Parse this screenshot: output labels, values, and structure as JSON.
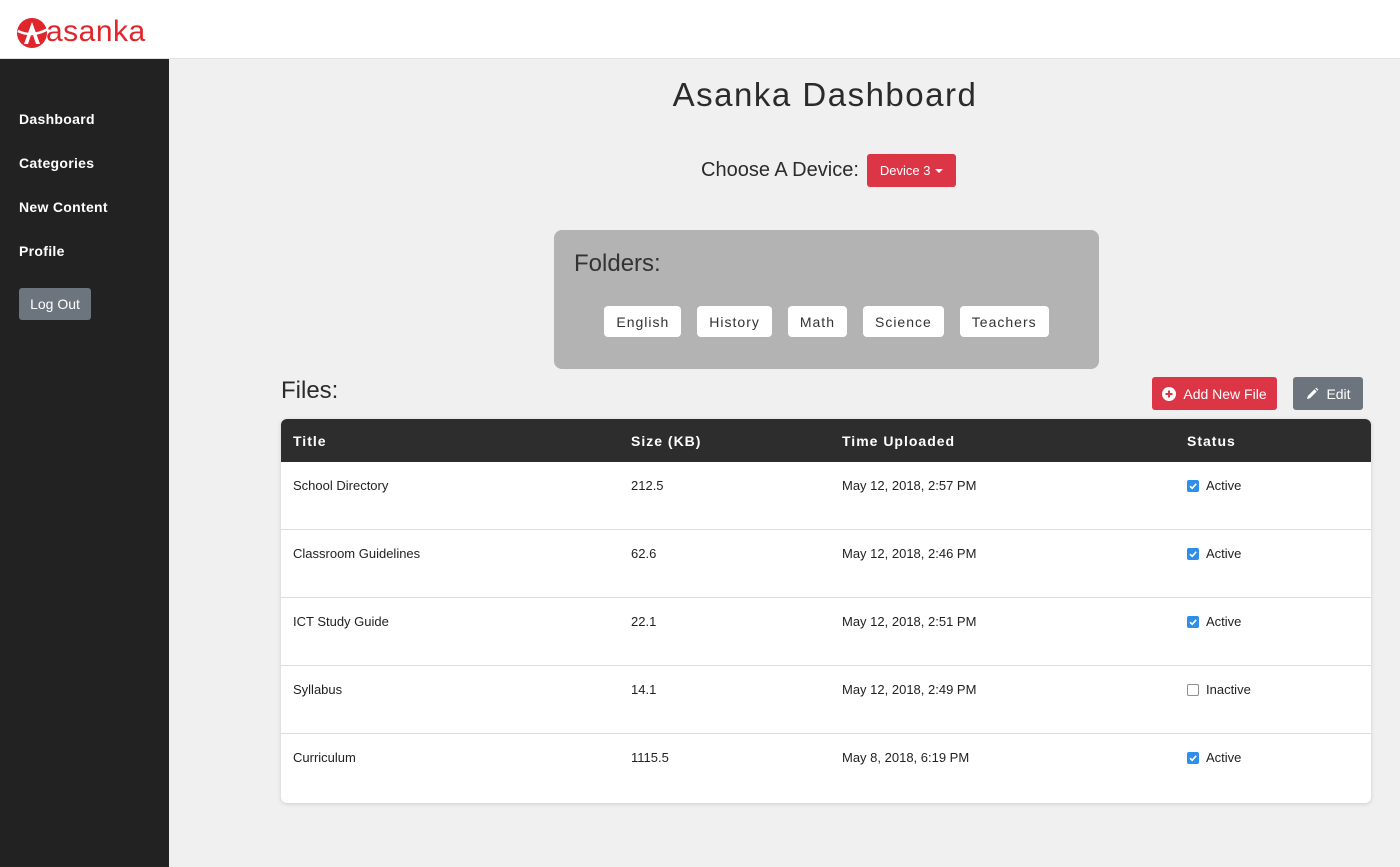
{
  "brand": {
    "name": "asanka",
    "color": "#e0262d"
  },
  "sidebar": {
    "items": [
      {
        "label": "Dashboard"
      },
      {
        "label": "Categories"
      },
      {
        "label": "New Content"
      },
      {
        "label": "Profile"
      }
    ],
    "logout_label": "Log Out"
  },
  "header": {
    "title": "Asanka Dashboard",
    "device_label": "Choose A Device:",
    "device_selected": "Device 3"
  },
  "folders": {
    "title": "Folders:",
    "items": [
      "English",
      "History",
      "Math",
      "Science",
      "Teachers"
    ]
  },
  "files": {
    "title": "Files:",
    "add_label": "Add New File",
    "edit_label": "Edit",
    "columns": [
      "Title",
      "Size (KB)",
      "Time Uploaded",
      "Status"
    ],
    "rows": [
      {
        "title": "School Directory",
        "size": "212.5",
        "time": "May 12, 2018, 2:57 PM",
        "status": "Active",
        "checked": true
      },
      {
        "title": "Classroom Guidelines",
        "size": "62.6",
        "time": "May 12, 2018, 2:46 PM",
        "status": "Active",
        "checked": true
      },
      {
        "title": "ICT Study Guide",
        "size": "22.1",
        "time": "May 12, 2018, 2:51 PM",
        "status": "Active",
        "checked": true
      },
      {
        "title": "Syllabus",
        "size": "14.1",
        "time": "May 12, 2018, 2:49 PM",
        "status": "Inactive",
        "checked": false
      },
      {
        "title": "Curriculum",
        "size": "1115.5",
        "time": "May 8, 2018, 6:19 PM",
        "status": "Active",
        "checked": true
      }
    ]
  },
  "colors": {
    "accent": "#dc3545",
    "secondary": "#6c757d",
    "sidebar": "#222222",
    "checkbox": "#2f8ee8"
  }
}
